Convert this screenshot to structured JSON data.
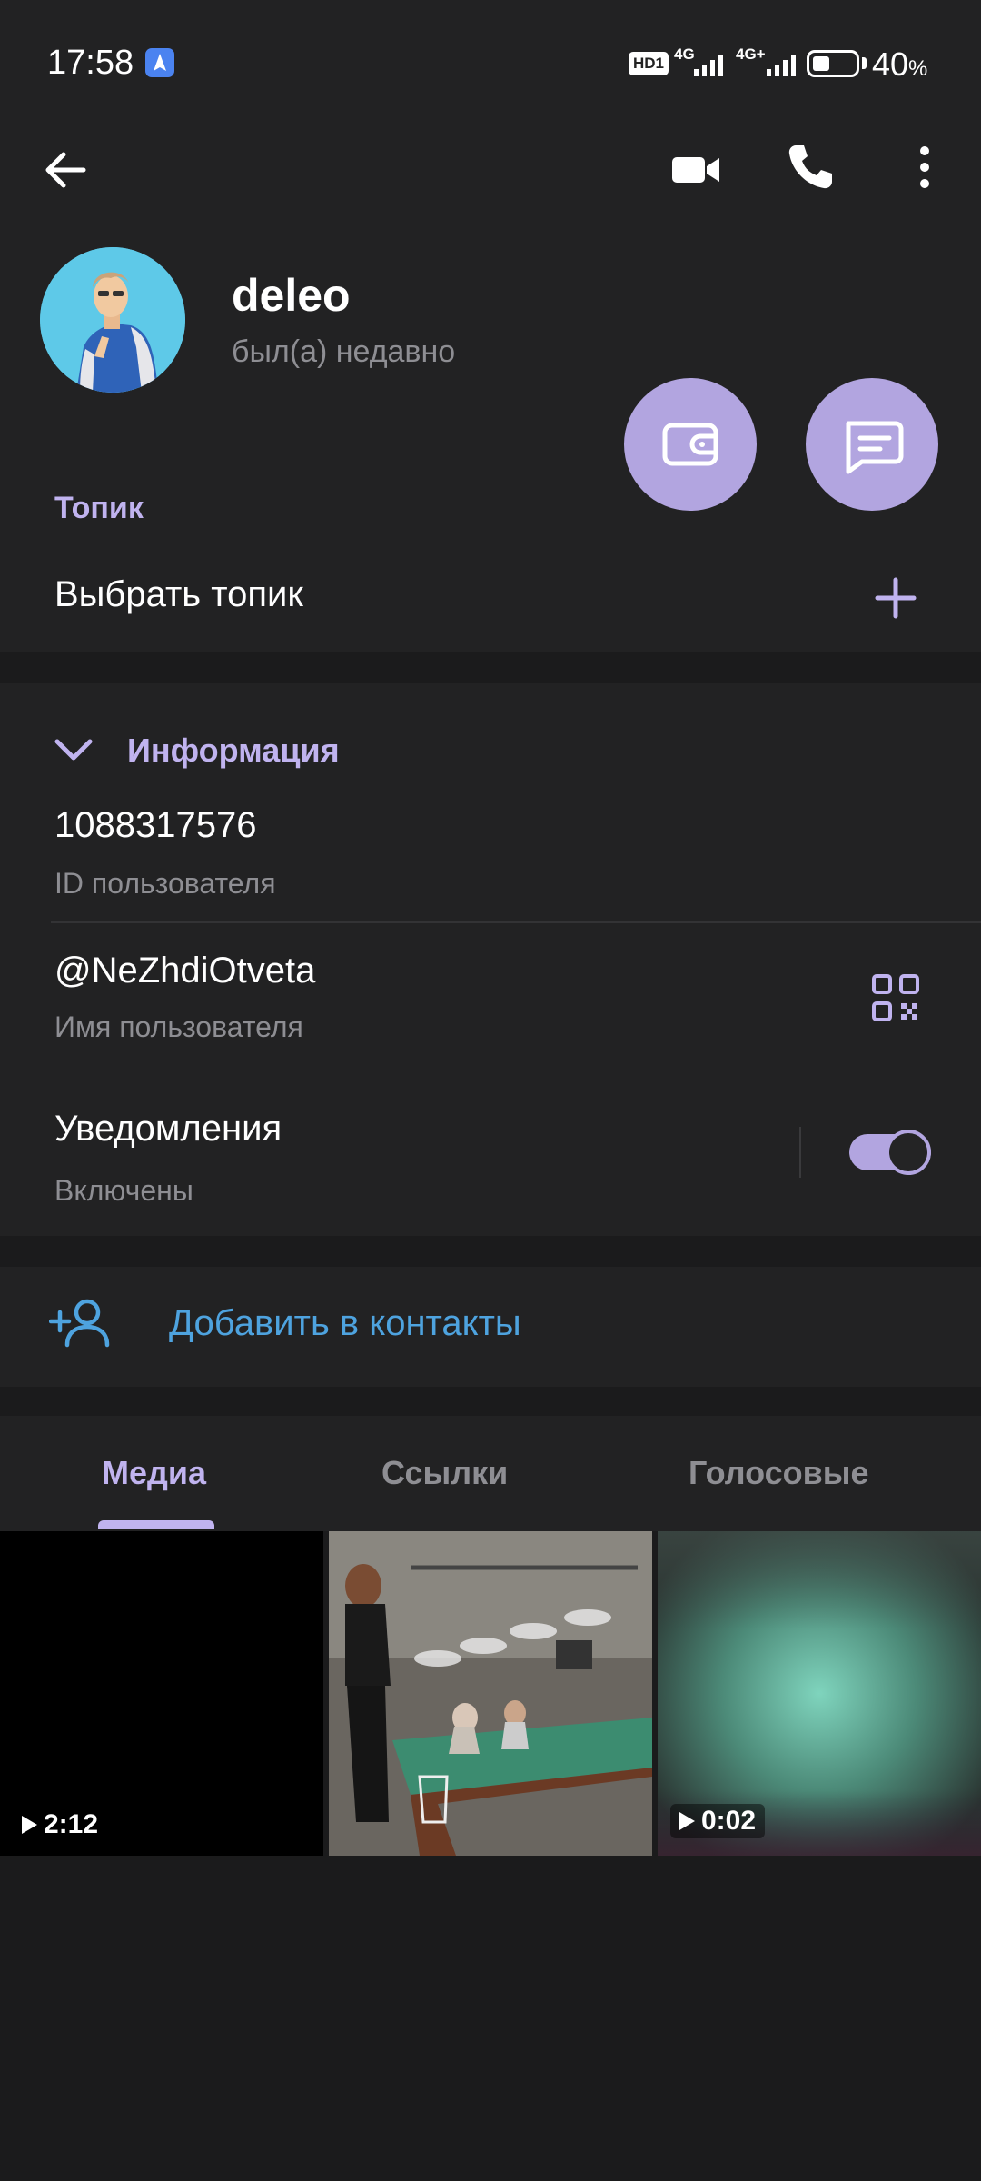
{
  "status_bar": {
    "time": "17:58",
    "hd": "HD1",
    "network1": "4G",
    "network2": "4G+",
    "battery_percent": "40",
    "battery_unit": "%",
    "battery_level": 0.4
  },
  "profile": {
    "name": "deleo",
    "last_seen": "был(а) недавно",
    "avatar_icon": "avatar-illustration"
  },
  "topic": {
    "label": "Топик",
    "choose": "Выбрать топик"
  },
  "info": {
    "title": "Информация",
    "user_id": "1088317576",
    "user_id_label": "ID пользователя",
    "username": "@NeZhdiOtveta",
    "username_label": "Имя пользователя",
    "notifications": "Уведомления",
    "notifications_state": "Включены",
    "notifications_on": true
  },
  "add_contact": {
    "label": "Добавить в контакты"
  },
  "tabs": [
    {
      "label": "Медиа",
      "active": true
    },
    {
      "label": "Ссылки",
      "active": false
    },
    {
      "label": "Голосовые",
      "active": false
    }
  ],
  "media": [
    {
      "type": "video",
      "duration": "2:12"
    },
    {
      "type": "photo"
    },
    {
      "type": "video",
      "duration": "0:02"
    }
  ],
  "colors": {
    "accent": "#c0b3ef",
    "fab": "#b2a5e0",
    "link": "#4ea3df",
    "background": "#1b1b1c",
    "surface": "#222223"
  }
}
